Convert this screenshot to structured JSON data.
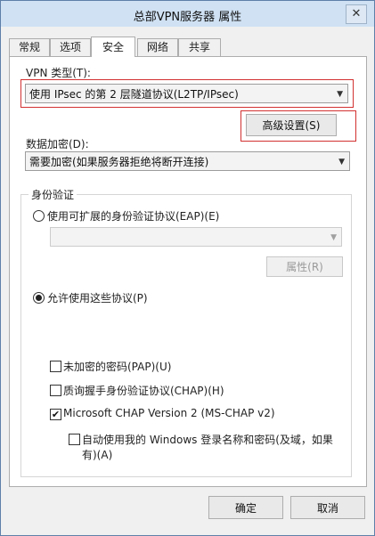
{
  "window": {
    "title": "总部VPN服务器 属性",
    "close_glyph": "✕"
  },
  "tabs": [
    {
      "label": "常规"
    },
    {
      "label": "选项"
    },
    {
      "label": "安全"
    },
    {
      "label": "网络"
    },
    {
      "label": "共享"
    }
  ],
  "active_tab": "安全",
  "vpn_type": {
    "label": "VPN 类型(T):",
    "value": "使用 IPsec 的第 2 层隧道协议(L2TP/IPsec)"
  },
  "advanced_button": "高级设置(S)",
  "data_encryption": {
    "label": "数据加密(D):",
    "value": "需要加密(如果服务器拒绝将断开连接)"
  },
  "authentication": {
    "group_title": "身份验证",
    "eap_radio": "使用可扩展的身份验证协议(EAP)(E)",
    "eap_select_value": "",
    "properties_button": "属性(R)",
    "allow_protocols_radio": "允许使用这些协议(P)",
    "selected_option": "allow_protocols",
    "protocols": [
      {
        "label": "未加密的密码(PAP)(U)",
        "checked": false
      },
      {
        "label": "质询握手身份验证协议(CHAP)(H)",
        "checked": false
      },
      {
        "label": "Microsoft CHAP Version 2 (MS-CHAP v2)",
        "checked": true
      }
    ],
    "auto_logon_line1": "自动使用我的 Windows 登录名称和密码(及域，如果",
    "auto_logon_line2": "有)(A)",
    "auto_logon_checked": false
  },
  "footer": {
    "ok_button": "确定",
    "cancel_button": "取消"
  },
  "icons": {
    "dropdown_arrow": "▼",
    "check_mark": "✔"
  },
  "colors": {
    "highlight_border": "#d23030",
    "titlebar": "#cfe1f3"
  }
}
